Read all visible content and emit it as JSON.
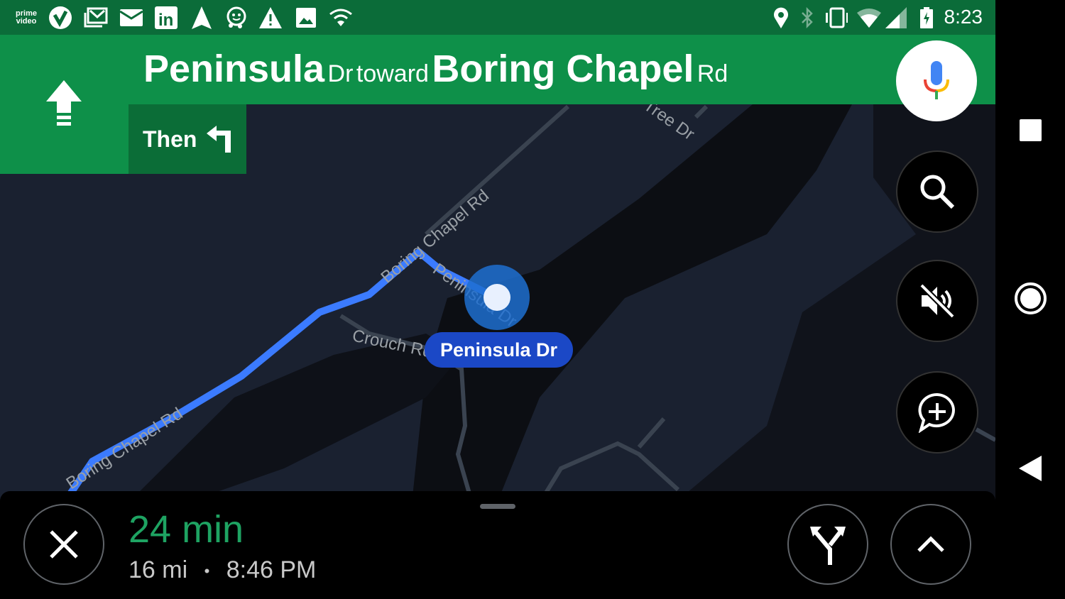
{
  "status_bar": {
    "left_icons": [
      "prime-video-icon",
      "verizon-check-icon",
      "gmail-stack-icon",
      "email-icon",
      "linkedin-icon",
      "navigation-arrow-icon",
      "waze-icon",
      "warning-icon",
      "image-icon",
      "wifi-icon"
    ],
    "prime_video_text": "prime video",
    "right_icons": [
      "location-icon",
      "bluetooth-icon",
      "vibrate-icon",
      "wifi-signal-icon",
      "cell-signal-icon",
      "battery-charging-icon"
    ],
    "time": "8:23"
  },
  "navigation": {
    "maneuver_icon": "straight-arrow-icon",
    "street_name": "Peninsula",
    "street_suffix": "Dr",
    "toward": "toward",
    "toward_name": "Boring Chapel",
    "toward_suffix": "Rd",
    "then_label": "Then",
    "then_icon": "turn-left-icon"
  },
  "map": {
    "road_labels": [
      "Boring Chapel Rd",
      "Boring Chapel Rd",
      "Crouch Rd",
      "Peninsula Dr",
      "Tree Dr"
    ],
    "current_road": "Peninsula Dr",
    "route_color": "#4285f4"
  },
  "controls": {
    "mic_icon": "microphone-icon",
    "search_icon": "search-icon",
    "mute_icon": "volume-off-icon",
    "report_icon": "add-report-icon"
  },
  "trip": {
    "duration": "24 min",
    "distance": "16 mi",
    "separator": "•",
    "arrival": "8:46 PM",
    "accent_color": "#1ea362"
  },
  "system_nav": [
    "stop-square-icon",
    "home-circle-icon",
    "back-triangle-icon"
  ]
}
